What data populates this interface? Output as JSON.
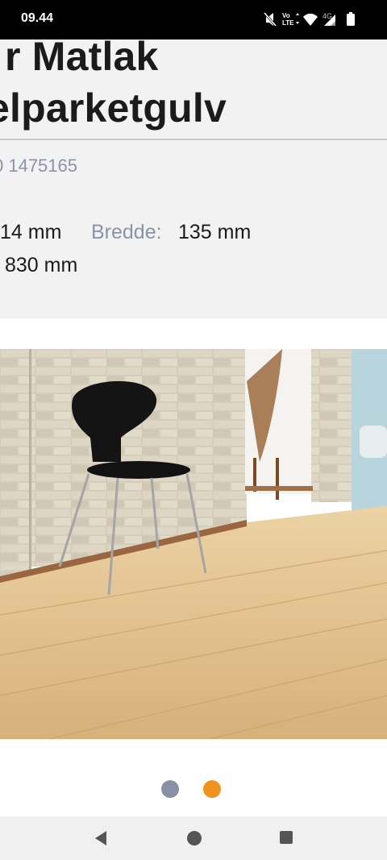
{
  "status_bar": {
    "time": "09.44",
    "icons": [
      "mute-icon",
      "volte-icon",
      "wifi-icon",
      "4g-signal-icon",
      "battery-icon"
    ],
    "network_label": "4G",
    "volte_label": "Vo LTE"
  },
  "product": {
    "title_line1": "r Matlak",
    "title_line2": "elparketgulv",
    "sku": "0 1475165",
    "specs": {
      "thickness_value": "14 mm",
      "width_label": "Bredde:",
      "width_value": "135 mm",
      "length_value": "830 mm"
    }
  },
  "carousel": {
    "dots": [
      {
        "color": "#8a8fa6",
        "active": false
      },
      {
        "color": "#f0921f",
        "active": true
      }
    ]
  },
  "nav_bar": {
    "buttons": [
      "back-icon",
      "home-icon",
      "recents-icon"
    ]
  },
  "colors": {
    "accent": "#f0921f",
    "muted_text": "#8a93a8",
    "panel_bg": "#f2f2f2"
  }
}
